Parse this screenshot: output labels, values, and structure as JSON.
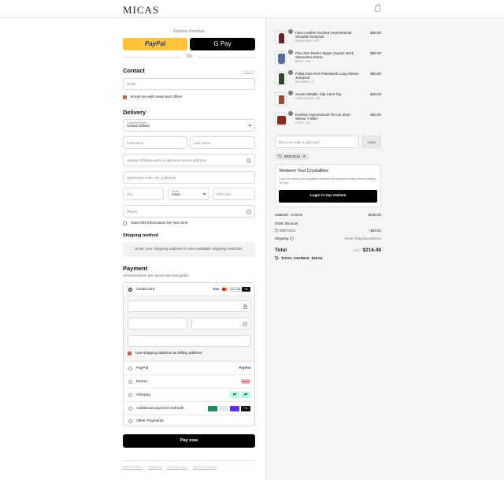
{
  "header": {
    "logo": "MICAS"
  },
  "express": {
    "label": "Express checkout",
    "paypal": "PayPal",
    "gpay": "G Pay",
    "or": "OR"
  },
  "contact": {
    "title": "Contact",
    "login": "Log in",
    "email_placeholder": "Email",
    "newsletter": "Email me with news and offers"
  },
  "delivery": {
    "title": "Delivery",
    "country_label": "Country/Region",
    "country_value": "United States",
    "first_name": "First name",
    "last_name": "Last name",
    "address": "Address (Please enter a valid and correct address)",
    "apartment": "Apartment, suite, etc. (optional)",
    "city": "City",
    "state_label": "State",
    "state_value": "Iowa",
    "zip": "ZIP code",
    "phone": "Phone",
    "save_info": "Save this information for next time"
  },
  "shipping": {
    "title": "Shipping method",
    "note": "Enter your shipping address to view available shipping methods."
  },
  "payment": {
    "title": "Payment",
    "subtitle": "All transactions are secure and encrypted.",
    "credit_card": "Credit card",
    "card_badges": [
      "VISA",
      "MC",
      "DISCOVER",
      "+5"
    ],
    "billing": "Use shipping address as billing address",
    "methods": [
      {
        "label": "PayPal",
        "badge": "PayPal"
      },
      {
        "label": "Klarna",
        "badge": "Klarna"
      },
      {
        "label": "Afterpay",
        "badge": ""
      },
      {
        "label": "Additional payment methods",
        "badge": "+3"
      },
      {
        "label": "Other Payments",
        "badge": ""
      }
    ]
  },
  "pay_now": "Pay now",
  "footer": {
    "links": [
      "Refund policy",
      "Shipping",
      "Privacy policy",
      "Terms of service"
    ]
  },
  "cart": {
    "items": [
      {
        "qty": "1",
        "name": "Faux Leather Ruched Asymmetrical Shoulder Bodysuit",
        "variant": "BURGUNDY / XS",
        "price": "$48.00",
        "color": "#6b1e22"
      },
      {
        "qty": "1",
        "name": "Plus Size Denim Zipper Square Neck Sleeveless Dress",
        "variant": "BLUE / 0XL",
        "price": "$68.00",
        "color": "#4f6f9a"
      },
      {
        "qty": "1",
        "name": "Polka Dots Print Patchwork Long Sleeve Jumpsuit",
        "variant": "MILITARY / S",
        "price": "$50.00",
        "color": "#2f4a2a"
      },
      {
        "qty": "1",
        "name": "Suede Metallic Slip Cami Top",
        "variant": "CHOCOLATE / XS",
        "price": "$48.00",
        "color": "#a0472f"
      },
      {
        "qty": "1",
        "name": "Ruched Asymmetrical Tie-Up Short Sleeve T-Shirt",
        "variant": "RUST / XS",
        "price": "$32.00",
        "color": "#8a2a1e"
      }
    ],
    "discount_placeholder": "Discount code or gift card",
    "apply": "Apply",
    "code": "BREYDI12",
    "crystallites_title": "Redeem Your Crystallites",
    "crystallites_text": "Log in to check your crystallites balance and explore exciting rewards waiting for you.",
    "crystallites_button": "Login in top redeem",
    "subtotal_label": "Subtotal · 5 items",
    "subtotal": "$246.00",
    "order_discount_label": "Order discount",
    "discount_code": "BREYDI12",
    "discount_value": "- $29.52",
    "shipping_label": "Shipping",
    "shipping_value": "Enter shipping address",
    "total_label": "Total",
    "currency": "USD",
    "total": "$216.48",
    "savings_label": "TOTAL SAVINGS",
    "savings": "$29.52"
  }
}
